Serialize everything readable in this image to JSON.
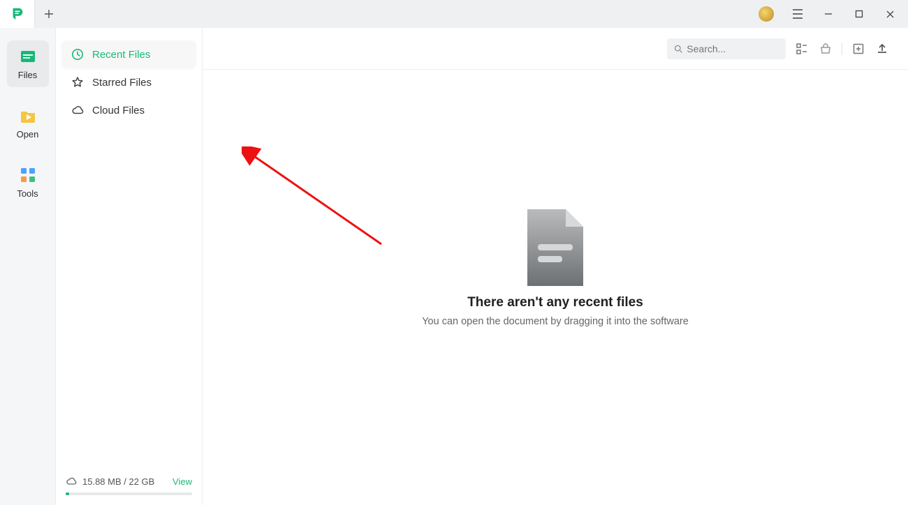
{
  "nav": {
    "items": [
      {
        "label": "Files"
      },
      {
        "label": "Open"
      },
      {
        "label": "Tools"
      }
    ]
  },
  "sidebar": {
    "items": [
      {
        "label": "Recent Files"
      },
      {
        "label": "Starred Files"
      },
      {
        "label": "Cloud Files"
      }
    ]
  },
  "storage": {
    "text": "15.88 MB / 22 GB",
    "view_label": "View"
  },
  "search": {
    "placeholder": "Search..."
  },
  "empty_state": {
    "title": "There aren't any recent files",
    "subtitle": "You can open the document by dragging it into the software"
  }
}
